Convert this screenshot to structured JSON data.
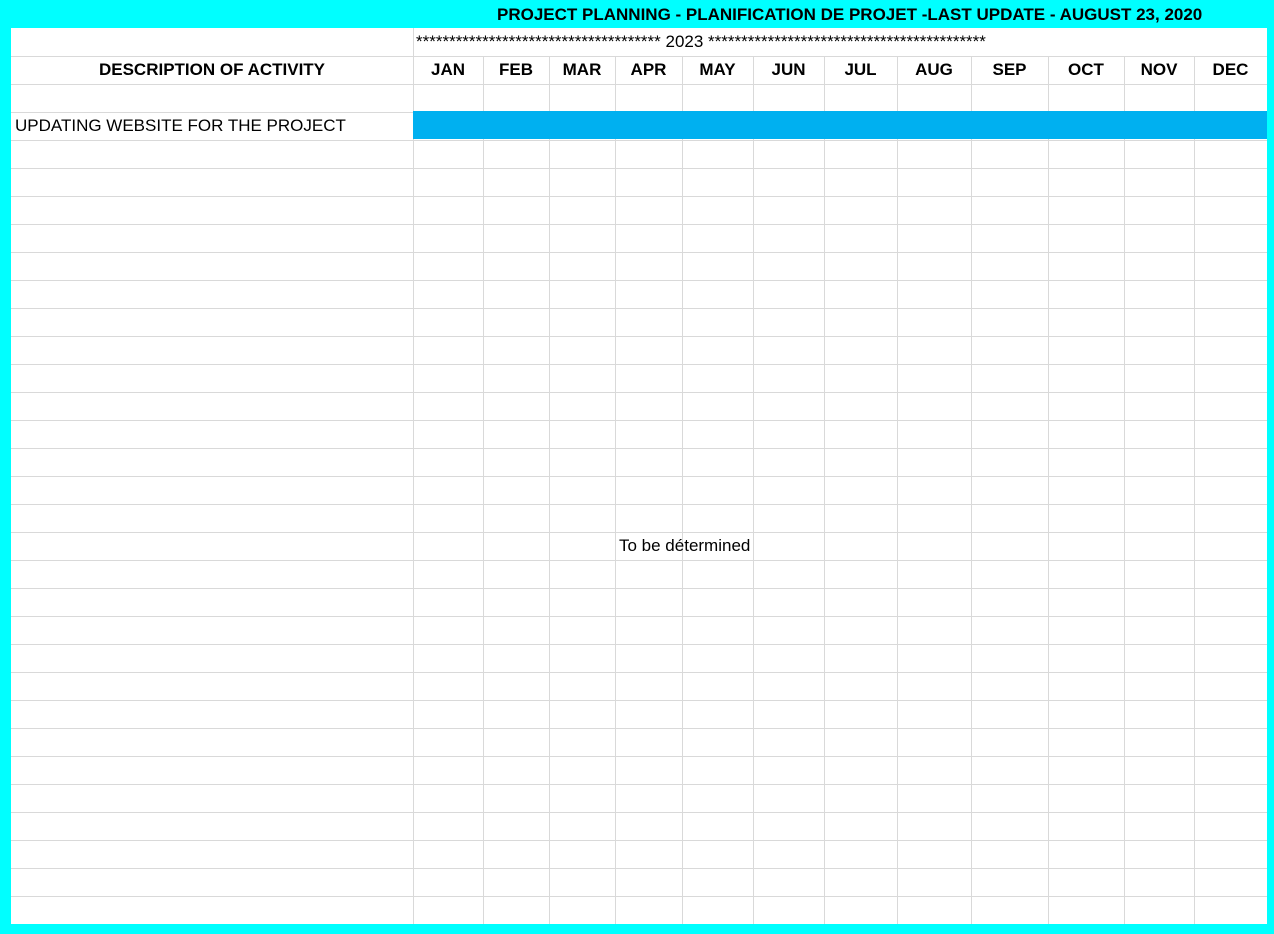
{
  "title": "PROJECT PLANNING - PLANIFICATION DE PROJET -LAST UPDATE - AUGUST 23, 2020",
  "year_line": "************************************* 2023 ******************************************",
  "description_header": "DESCRIPTION OF ACTIVITY",
  "months": [
    "JAN",
    "FEB",
    "MAR",
    "APR",
    "MAY",
    "JUN",
    "JUL",
    "AUG",
    "SEP",
    "OCT",
    "NOV",
    "DEC"
  ],
  "activities": [
    {
      "name": "UPDATING WEBSITE FOR THE PROJECT",
      "start_month": "JAN",
      "end_month": "DEC",
      "bar_color": "#00b0f0"
    }
  ],
  "note": "To be détermined",
  "colors": {
    "border": "#00ffff",
    "gridline": "#d9d9d9",
    "bar": "#00b0f0"
  }
}
